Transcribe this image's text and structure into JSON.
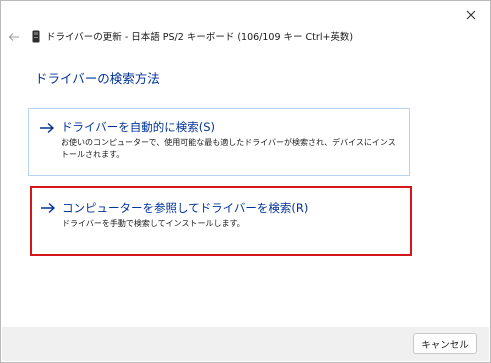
{
  "window": {
    "title": "ドライバーの更新 - 日本語 PS/2 キーボード (106/109 キー Ctrl+英数)",
    "close_icon": "close-icon",
    "back_icon": "back-arrow-icon",
    "device_icon": "keyboard-device-icon"
  },
  "main": {
    "heading": "ドライバーの検索方法",
    "options": [
      {
        "title": "ドライバーを自動的に検索(S)",
        "description": "お使いのコンピューターで、使用可能な最も適したドライバーが検索され、デバイスにインストールされます。",
        "icon": "arrow-right-icon"
      },
      {
        "title": "コンピューターを参照してドライバーを検索(R)",
        "description": "ドライバーを手動で検索してインストールします。",
        "icon": "arrow-right-icon",
        "highlighted": true
      }
    ]
  },
  "footer": {
    "cancel_label": "キャンセル"
  },
  "colors": {
    "accent_text": "#003399",
    "highlight_border": "#d4161b",
    "option_border": "#b6d4ef",
    "footer_bg": "#f0f0f0"
  }
}
